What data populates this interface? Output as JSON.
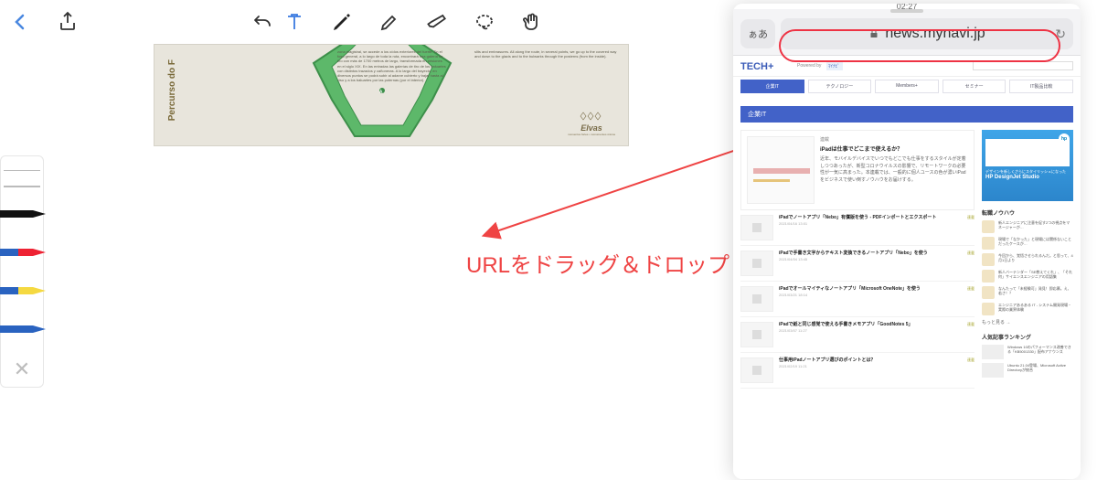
{
  "time": "02:27",
  "safari": {
    "aa": "ぁあ",
    "url": "news.mynavi.jp"
  },
  "annotation": "URLをドラッグ＆ドロップ",
  "doc": {
    "vertical": "Percurso do F",
    "elvas": "Elvas",
    "elvas_sub": "momentos fortes • monumentos únicos",
    "col1": "zona magistral, se accede a los oídos exteriores del fuerte. En el foso general, a lo largo de toda la ruta, encontrará una galería de tiro con más de 1700 metros de largo, transformada en prisiones en el siglo XIX. En las entradas las galerías de tiro de los baluartes con distintos trazados y cañoneras. A lo largo del trayecto, en diversos puntos se podrá subir al adarve cubierto y bajar hasta al viso y a los baluartes por las poternas (por el interior).",
    "col2": "slits and embrasures. All along the route, in several points, we go up to the covered way and down to the glacis and to the bulwarks through the posterns (from the inside)."
  },
  "mynavi": {
    "powered": "Powered by",
    "nav": [
      "企業IT",
      "テクノロジー",
      "Members+",
      "セミナー",
      "IT製品比較"
    ],
    "section": "企業IT",
    "feature": {
      "tag": "連載",
      "title": "iPadは仕事でどこまで使えるか？",
      "desc": "近年、モバイルデバイスでいつでもどこでも仕事をするスタイルが定着しつつあったが、新型コロナウイルスの影響で、リモートワークの必要性が一気に高まった。本連載では、一般的に個人ユースの色が濃いiPadをビジネスで使い倒すノウハウをお届けする。"
    },
    "articles": [
      {
        "t": "iPadでノートアプリ「Nebo」有償版を使う - PDFインポートとエクスポート",
        "d": "2021/04/16 13:01",
        "b": "連載"
      },
      {
        "t": "iPadで手書き文字からテキスト変換できるノートアプリ「Nebo」を使う",
        "d": "2021/04/04 13:45",
        "b": "連載"
      },
      {
        "t": "iPadでオールマイティなノートアプリ「Microsoft OneNote」を使う",
        "d": "2021/03/21 18:14",
        "b": "連載"
      },
      {
        "t": "iPadで紙と同じ感覚で使える手書きメモアプリ「GoodNotes 5」",
        "d": "2021/03/07 11:27",
        "b": "連載"
      },
      {
        "t": "仕事用iPadノートアプリ選びのポイントとは？",
        "d": "2021/02/19 11:21",
        "b": "連載"
      }
    ],
    "banner": {
      "line1": "デザインを新しくさらにスタイリッシュになった",
      "line2": "HP DesignJet Studio",
      "hp": "hp"
    },
    "side_h1": "転職ノウハウ",
    "side_items": [
      "新人エンジニアに注意を促す2つの視点をマネージャーが…",
      "現場で「なかった」と現場には関係ないことだったケースが…",
      "今回から、覚悟させられるんだ。と思って、4月1日より",
      "新人バーテンダー「SE教えてくれ」、「それ何」サイエンスエンジニアの用語集",
      "なんたって「未経験可」発見！即応募。え、若さ！？",
      "エンジニアあるある IT - システム開発現場・実際の業界体験"
    ],
    "more": "もっと見る →",
    "rank_h": "人気記事ランキング",
    "ranks": [
      "Windows 10のパフォーマンス改善できる「KB5001330」配布アナウンス",
      "Ubuntu 21.04登場、Microsoft Active Directoryが統合"
    ]
  }
}
